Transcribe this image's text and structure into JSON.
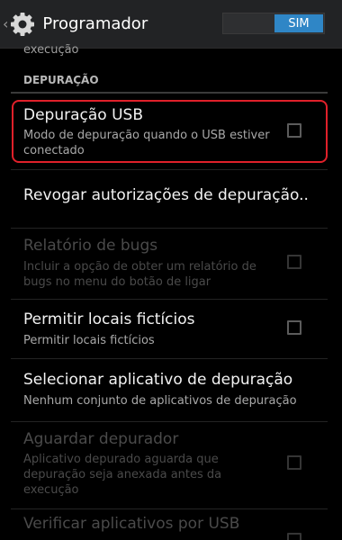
{
  "action_bar": {
    "title": "Programador",
    "toggle_label": "SIM",
    "icons": {
      "up": "chevron-left-icon",
      "app": "gear-icon"
    }
  },
  "prev_item_summary_tail": "execução",
  "section": {
    "title": "DEPURAÇÃO",
    "items": [
      {
        "title": "Depuração USB",
        "summary": "Modo de depuração quando o USB estiver conectado",
        "checkbox": true,
        "checked": false,
        "enabled": true,
        "highlighted": true
      },
      {
        "title": "Revogar autorizações de depuração..",
        "checkbox": false,
        "enabled": true
      },
      {
        "title": "Relatório de bugs",
        "summary": "Incluir a opção de obter um relatório de bugs no menu do botão de ligar",
        "checkbox": true,
        "checked": false,
        "enabled": false
      },
      {
        "title": "Permitir locais fictícios",
        "summary": "Permitir locais fictícios",
        "checkbox": true,
        "checked": false,
        "enabled": true
      },
      {
        "title": "Selecionar aplicativo de depuração",
        "summary": "Nenhum conjunto de aplicativos de depuração",
        "checkbox": false,
        "enabled": true
      },
      {
        "title": "Aguardar depurador",
        "summary": "Aplicativo depurado aguarda que depuração seja anexada antes da execução",
        "checkbox": true,
        "checked": false,
        "enabled": false
      },
      {
        "title": "Verificar aplicativos por USB",
        "checkbox": true,
        "checked": false,
        "enabled": false
      }
    ]
  },
  "colors": {
    "background": "#000000",
    "action_bar": "#222325",
    "accent": "#2f86c6",
    "highlight": "#e0202a",
    "disabled_text": "#4a4a4a"
  }
}
